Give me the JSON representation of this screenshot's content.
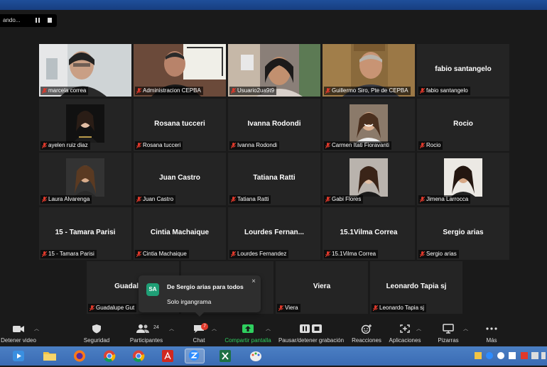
{
  "recording": {
    "status_text": "ando..."
  },
  "participants": [
    {
      "label": "marcela correa",
      "big": "",
      "photo": "marcela"
    },
    {
      "label": "Administracion CEPBA",
      "big": "",
      "photo": "admin"
    },
    {
      "label": "Usuario2ua9t9",
      "big": "",
      "photo": "usuario"
    },
    {
      "label": "Guillermo Siro, Pte de CEPBA",
      "big": "",
      "photo": "guillermo",
      "active": true
    },
    {
      "label": "fabio santangelo",
      "big": "fabio santangelo"
    },
    {
      "label": "ayelen ruiz diaz",
      "big": "",
      "photo": "ayelen"
    },
    {
      "label": "Rosana tucceri",
      "big": "Rosana tucceri"
    },
    {
      "label": "Ivanna Rodondi",
      "big": "Ivanna Rodondi"
    },
    {
      "label": "Carmen Itati Fioravanti",
      "big": "",
      "photo": "carmen"
    },
    {
      "label": "Rocio",
      "big": "Rocio"
    },
    {
      "label": "Laura Alvarenga",
      "big": "",
      "photo": "laura"
    },
    {
      "label": "Juan Castro",
      "big": "Juan Castro"
    },
    {
      "label": "Tatiana Ratti",
      "big": "Tatiana Ratti"
    },
    {
      "label": "Gabi Flores",
      "big": "",
      "photo": "gabi"
    },
    {
      "label": "Jimena Larrocca",
      "big": "",
      "photo": "jimena"
    },
    {
      "label": "15 - Tamara Parisi",
      "big": "15 - Tamara Parisi"
    },
    {
      "label": "Cintia Machaique",
      "big": "Cintia Machaique"
    },
    {
      "label": "Lourdes Fernandez",
      "big": "Lourdes  Fernan..."
    },
    {
      "label": "15.1Vilma Correa",
      "big": "15.1Vilma Correa"
    },
    {
      "label": "Sergio arias",
      "big": "Sergio arias"
    },
    {
      "label": "Guadalupe Gut",
      "big": "Guadalupe"
    },
    {
      "label": "",
      "big": ""
    },
    {
      "label": "Viera",
      "big": "Viera"
    },
    {
      "label": "Leonardo Tapia sj",
      "big": "Leonardo Tapia sj"
    }
  ],
  "chat_popup": {
    "avatar": "SA",
    "from": "De Sergio arias para todos",
    "message": "Solo irgangrama",
    "close": "×"
  },
  "toolbar": {
    "video": "Detener video",
    "security": "Seguridad",
    "participants": "Participantes",
    "participants_count": "24",
    "chat": "Chat",
    "chat_unread": "7",
    "share": "Compartir pantalla",
    "record": "Pausar/detener grabación",
    "reactions": "Reacciones",
    "apps": "Aplicaciones",
    "whiteboards": "Pizarras",
    "more": "Más"
  },
  "colors": {
    "active_speaker": "#c6e85a",
    "share_green": "#2fcf5f",
    "chat_avatar": "#1f9f76",
    "muted_red": "#e0392b"
  }
}
